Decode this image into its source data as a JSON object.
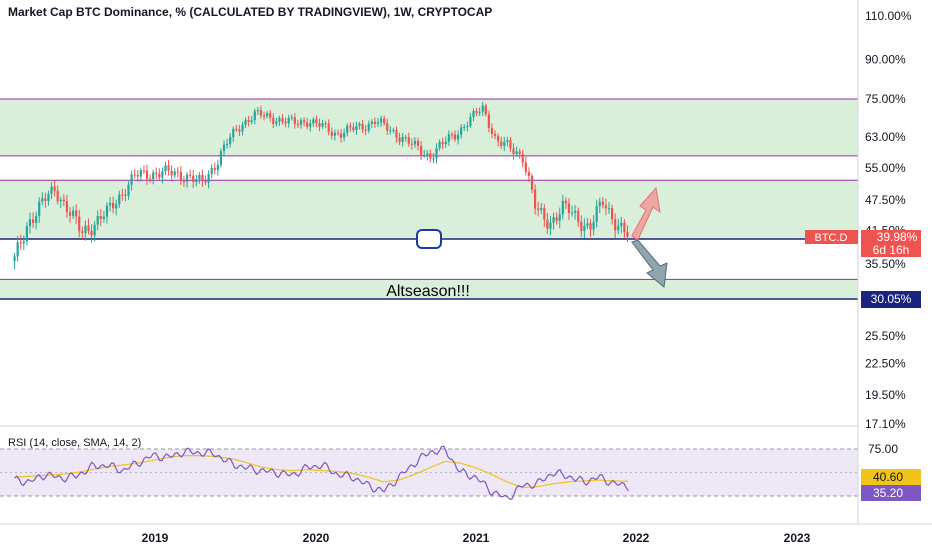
{
  "header": {
    "title": "Market Cap BTC Dominance, % (CALCULATED BY TRADINGVIEW), 1W, CRYPTOCAP"
  },
  "rsi": {
    "label": "RSI (14, close, SMA, 14, 2)",
    "rsi_value": "35.20",
    "sma_value": "40.60",
    "levels": [
      "75.00",
      "25.00"
    ]
  },
  "annotation": {
    "text": "Altseason!!!"
  },
  "price_badge": {
    "symbol": "BTC.D",
    "value": "39.98%",
    "countdown": "6d 16h"
  },
  "level_badge": {
    "value": "30.05%"
  },
  "colors": {
    "up": "#26a69a",
    "down": "#ef5350",
    "zone": "#d9efd9",
    "zone_line": "#9c27b0",
    "support": "#1a237e",
    "rsi_line": "#7e57c2",
    "rsi_band": "#ede7f6",
    "sma": "#f0c419",
    "arrow_up": "#ef9a9a",
    "arrow_down": "#90a4ae"
  },
  "chart_data": [
    {
      "type": "candlestick",
      "title": "Market Cap BTC Dominance, % (CALCULATED BY TRADINGVIEW), 1W, CRYPTOCAP",
      "y_scale": "log",
      "y_ticks": [
        "110.00%",
        "90.00%",
        "75.00%",
        "63.00%",
        "55.00%",
        "47.50%",
        "41.50%",
        "35.50%",
        "30.05%",
        "25.50%",
        "22.50%",
        "19.50%",
        "17.10%"
      ],
      "x_ticks": [
        "2019",
        "2020",
        "2021",
        "2022",
        "2023"
      ],
      "series": [
        {
          "name": "BTC.D",
          "x": [
            "2018-02",
            "2018-03",
            "2018-05",
            "2018-07",
            "2018-09",
            "2018-11",
            "2019-01",
            "2019-03",
            "2019-04",
            "2019-05",
            "2019-06",
            "2019-07",
            "2019-08",
            "2019-09",
            "2019-10",
            "2019-11",
            "2019-12",
            "2020-01",
            "2020-02",
            "2020-03",
            "2020-04",
            "2020-05",
            "2020-06",
            "2020-07",
            "2020-08",
            "2020-09",
            "2020-10",
            "2020-11",
            "2020-12",
            "2021-01",
            "2021-02",
            "2021-03",
            "2021-04",
            "2021-05",
            "2021-06",
            "2021-07",
            "2021-08",
            "2021-09",
            "2021-10",
            "2021-11",
            "2021-12"
          ],
          "y": [
            36,
            43,
            50,
            41,
            45,
            53,
            54,
            53,
            51,
            56,
            62,
            67,
            70,
            69,
            68,
            67,
            68,
            66,
            64,
            65,
            66,
            68,
            65,
            63,
            60,
            58,
            61,
            64,
            68,
            72,
            62,
            60,
            58,
            45,
            43,
            46,
            44,
            42,
            47,
            43,
            39.98
          ]
        }
      ],
      "horizontal_levels": [
        {
          "value": 75.0
        },
        {
          "value": 58.0
        },
        {
          "value": 52.0
        },
        {
          "value": 39.98
        },
        {
          "value": 33.0
        },
        {
          "value": 30.05
        }
      ]
    },
    {
      "type": "line",
      "title": "RSI (14, close, SMA, 14, 2)",
      "ylim": [
        25,
        75
      ],
      "series": [
        {
          "name": "RSI",
          "y": [
            42,
            40,
            48,
            44,
            46,
            56,
            58,
            52,
            60,
            68,
            66,
            72,
            71,
            70,
            60,
            55,
            52,
            50,
            47,
            55,
            58,
            48,
            45,
            36,
            30,
            45,
            60,
            72,
            74,
            50,
            45,
            30,
            22,
            36,
            38,
            50,
            46,
            40,
            45,
            38,
            35.2
          ]
        },
        {
          "name": "SMA",
          "y": [
            45,
            46,
            47,
            48,
            50,
            53,
            56,
            58,
            60,
            63,
            66,
            68,
            68,
            67,
            65,
            61,
            56,
            53,
            52,
            53,
            52,
            51,
            49,
            45,
            40,
            42,
            48,
            55,
            62,
            60,
            55,
            48,
            40,
            34,
            35,
            38,
            40,
            41,
            42,
            41,
            40.6
          ]
        }
      ]
    }
  ]
}
